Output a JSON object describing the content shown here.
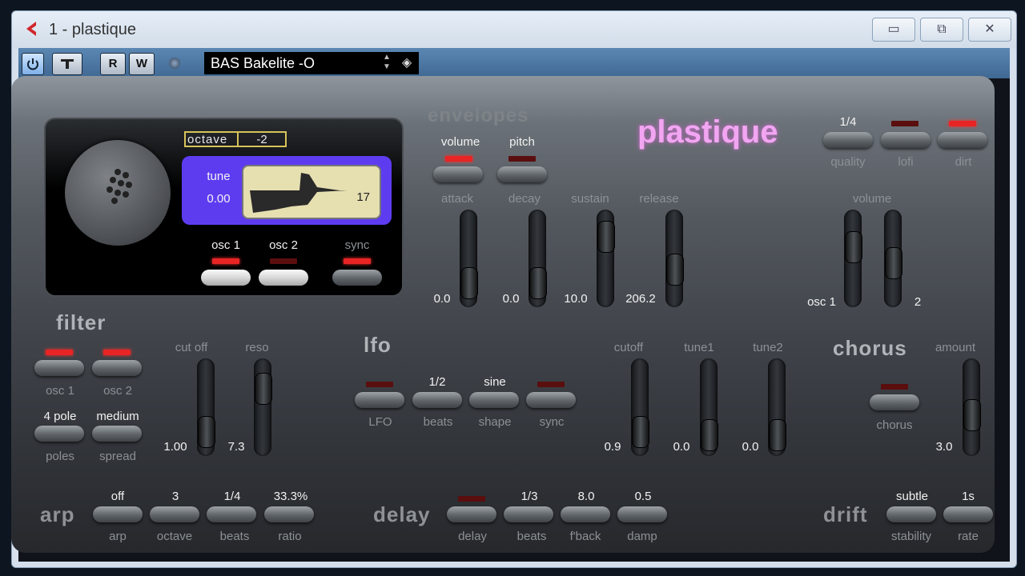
{
  "window": {
    "title": "1 - plastique",
    "minimize_label": "▭",
    "maximize_label": "⧉",
    "close_label": "✕"
  },
  "toolbar": {
    "r_label": "R",
    "w_label": "W",
    "preset": "BAS Bakelite -O"
  },
  "logo": "plastique",
  "osc": {
    "octave_label": "octave",
    "octave_value": "-2",
    "tune_label": "tune",
    "tune_value": "0.00",
    "wave_number": "17",
    "osc1_label": "osc 1",
    "osc2_label": "osc 2",
    "sync_label": "sync",
    "osc1_led": true,
    "osc2_led": false,
    "sync_led": true
  },
  "envelopes": {
    "title": "envelopes",
    "volume_label": "volume",
    "pitch_label": "pitch",
    "volume_led": true,
    "pitch_led": false,
    "attack": {
      "label": "attack",
      "value": "0.0",
      "level": 0.15
    },
    "decay": {
      "label": "decay",
      "value": "0.0",
      "level": 0.15
    },
    "sustain": {
      "label": "sustain",
      "value": "10.0",
      "level": 0.85
    },
    "release": {
      "label": "release",
      "value": "206.2",
      "level": 0.35
    }
  },
  "master": {
    "quality_value": "1/4",
    "quality_label": "quality",
    "lofi_label": "lofi",
    "dirt_label": "dirt",
    "lofi_led": false,
    "dirt_led": true,
    "volume_label": "volume",
    "osc1_label": "osc 1",
    "osc2_label": "2",
    "osc1_level": 0.7,
    "osc2_level": 0.45
  },
  "filter": {
    "title": "filter",
    "osc1_label": "osc 1",
    "osc2_label": "osc 2",
    "osc1_led": true,
    "osc2_led": true,
    "poles_value": "4 pole",
    "poles_label": "poles",
    "spread_value": "medium",
    "spread_label": "spread",
    "cutoff": {
      "label": "cut off",
      "value": "1.00",
      "level": 0.15
    },
    "reso": {
      "label": "reso",
      "value": "7.3",
      "level": 0.8
    }
  },
  "lfo": {
    "title": "lfo",
    "lfo_label": "LFO",
    "beats_value": "1/2",
    "beats_label": "beats",
    "shape_value": "sine",
    "shape_label": "shape",
    "sync_label": "sync",
    "lfo_led": false,
    "sync_led": false,
    "cutoff": {
      "label": "cutoff",
      "value": "0.9",
      "level": 0.15
    },
    "tune1": {
      "label": "tune1",
      "value": "0.0",
      "level": 0.1
    },
    "tune2": {
      "label": "tune2",
      "value": "0.0",
      "level": 0.1
    }
  },
  "chorus": {
    "title": "chorus",
    "label": "chorus",
    "led": false,
    "amount": {
      "label": "amount",
      "value": "3.0",
      "level": 0.4
    }
  },
  "arp": {
    "title": "arp",
    "arp_value": "off",
    "arp_label": "arp",
    "octave_value": "3",
    "octave_label": "octave",
    "beats_value": "1/4",
    "beats_label": "beats",
    "ratio_value": "33.3%",
    "ratio_label": "ratio"
  },
  "delay": {
    "title": "delay",
    "delay_label": "delay",
    "delay_led": false,
    "beats_value": "1/3",
    "beats_label": "beats",
    "fback_value": "8.0",
    "fback_label": "f'back",
    "damp_value": "0.5",
    "damp_label": "damp"
  },
  "drift": {
    "title": "drift",
    "stability_value": "subtle",
    "stability_label": "stability",
    "rate_value": "1s",
    "rate_label": "rate"
  }
}
